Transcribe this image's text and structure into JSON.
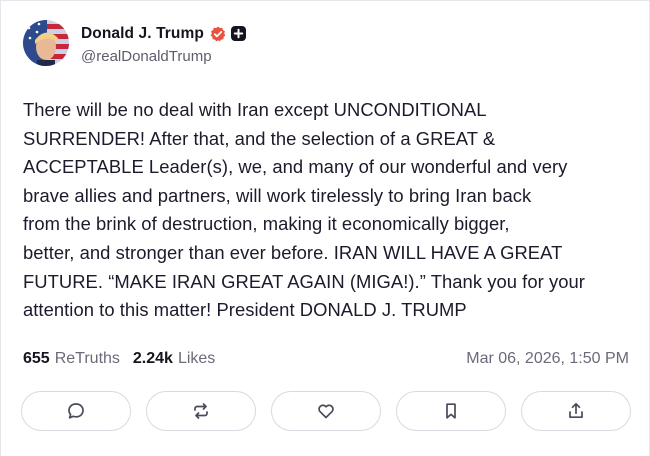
{
  "author": {
    "display_name": "Donald J. Trump",
    "handle": "@realDonaldTrump",
    "verified_icon": "verified-badge-icon",
    "plus_icon": "plus-badge-icon"
  },
  "post": {
    "text": "There will be no deal with Iran except UNCONDITIONAL\nSURRENDER! After that, and the selection of a GREAT &\nACCEPTABLE Leader(s), we, and many of our wonderful and very\nbrave allies and partners, will work tirelessly to bring Iran back\nfrom the brink of destruction, making it economically bigger,\nbetter, and stronger than ever before. IRAN WILL HAVE A GREAT\nFUTURE. “MAKE IRAN GREAT AGAIN (MIGA!).” Thank you for your\nattention to this matter! President DONALD J. TRUMP"
  },
  "stats": {
    "retruths_count": "655",
    "retruths_label": "ReTruths",
    "likes_count": "2.24k",
    "likes_label": "Likes",
    "timestamp": "Mar 06, 2026, 1:50 PM"
  },
  "actions": [
    {
      "icon": "reply-icon"
    },
    {
      "icon": "retruth-icon"
    },
    {
      "icon": "like-icon"
    },
    {
      "icon": "bookmark-icon"
    },
    {
      "icon": "share-icon"
    }
  ],
  "colors": {
    "verified": "#e8523f",
    "icon": "#4a4a5a",
    "border": "#d9d9e1"
  }
}
